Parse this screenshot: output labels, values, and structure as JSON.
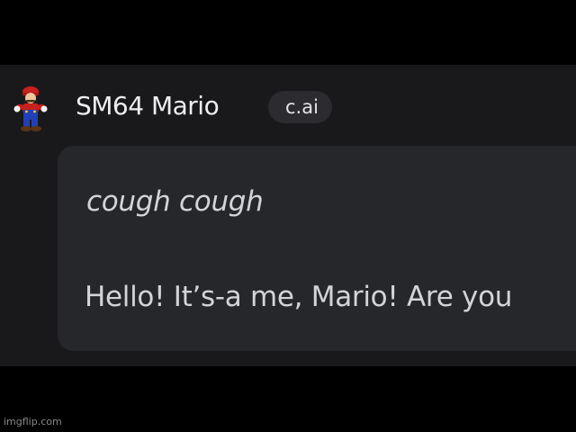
{
  "chat": {
    "bot_name": "SM64 Mario",
    "badge": "c.ai",
    "avatar_icon": "mario-avatar-icon",
    "message": {
      "action": "cough cough",
      "text": "Hello! It’s-a me, Mario! Are you"
    }
  },
  "watermark": "imgflip.com",
  "colors": {
    "background": "#000000",
    "panel": "#19191c",
    "bubble": "#26272b",
    "badge": "#2b2b30",
    "text": "#d4d4d7"
  }
}
